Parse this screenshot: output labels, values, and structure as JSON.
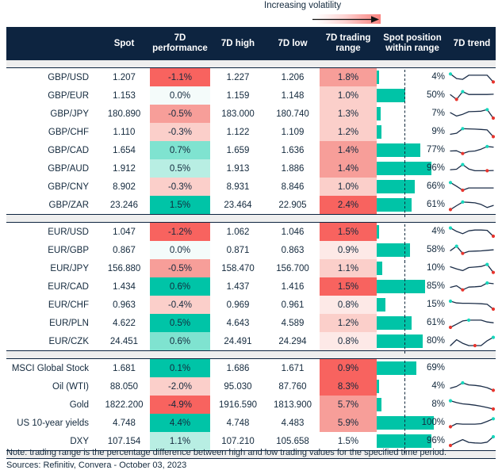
{
  "annotation": {
    "volatility_label": "Increasing volatility"
  },
  "columns": [
    {
      "key": "name",
      "label": ""
    },
    {
      "key": "spot",
      "label": "Spot"
    },
    {
      "key": "perf",
      "label": "7D performance"
    },
    {
      "key": "high",
      "label": "7D high"
    },
    {
      "key": "low",
      "label": "7D low"
    },
    {
      "key": "range",
      "label": "7D trading range"
    },
    {
      "key": "pos",
      "label": "Spot position within range"
    },
    {
      "key": "trend",
      "label": "7D trend"
    }
  ],
  "header": {
    "name": "",
    "spot": "Spot",
    "perf_line1": "7D",
    "perf_line2": "performance",
    "high": "7D high",
    "low": "7D low",
    "range_line1": "7D trading",
    "range_line2": "range",
    "pos_line1": "Spot position",
    "pos_line2": "within range",
    "trend": "7D trend"
  },
  "colors": {
    "header_bg": "#0d2440",
    "teal_strong": "#00c4a7",
    "teal_mid": "#7fe3d0",
    "teal_light": "#b8eee3",
    "red_strong": "#f8635f",
    "red_mid": "#f79e99",
    "red_light": "#fbcfca",
    "neutral": "#f4fbfa",
    "bar": "#00c4a7",
    "spark_line": "#1b2d48",
    "spark_high": "#16d8bd",
    "spark_low": "#e8352e",
    "text": "#13293d"
  },
  "sections": [
    {
      "id": "gbp",
      "rows": [
        {
          "name": "GBP/USD",
          "spot": "1.207",
          "perf": "-1.1%",
          "perf_color": "#f8635f",
          "high": "1.227",
          "low": "1.206",
          "range": "1.8%",
          "range_color": "#f79e99",
          "pos": "4%",
          "pos_pct": 4,
          "trend": [
            0.18,
            0.62,
            0.7,
            0.3,
            0.3,
            0.3,
            0.3,
            0.95
          ],
          "trend_high_i": 0,
          "trend_low_i": 7
        },
        {
          "name": "GBP/EUR",
          "spot": "1.153",
          "perf": "0.0%",
          "perf_color": "#f4fbfa",
          "high": "1.159",
          "low": "1.148",
          "range": "1.0%",
          "range_color": "#fbcfca",
          "pos": "50%",
          "pos_pct": 50,
          "trend": [
            0.42,
            0.88,
            0.12,
            0.4,
            0.4,
            0.4,
            0.4,
            0.38
          ],
          "trend_high_i": 2,
          "trend_low_i": 1
        },
        {
          "name": "GBP/JPY",
          "spot": "180.890",
          "perf": "-0.5%",
          "perf_color": "#f79e99",
          "high": "183.000",
          "low": "180.740",
          "range": "1.3%",
          "range_color": "#fbcfca",
          "pos": "7%",
          "pos_pct": 7,
          "trend": [
            0.4,
            0.72,
            0.55,
            0.3,
            0.28,
            0.25,
            0.1,
            0.92
          ],
          "trend_high_i": 6,
          "trend_low_i": 7
        },
        {
          "name": "GBP/CHF",
          "spot": "1.110",
          "perf": "-0.3%",
          "perf_color": "#fbcfca",
          "high": "1.122",
          "low": "1.109",
          "range": "1.2%",
          "range_color": "#fbcfca",
          "pos": "9%",
          "pos_pct": 9,
          "trend": [
            0.72,
            0.62,
            0.18,
            0.2,
            0.22,
            0.25,
            0.3,
            0.95
          ],
          "trend_high_i": 2,
          "trend_low_i": 7
        },
        {
          "name": "GBP/CAD",
          "spot": "1.654",
          "perf": "0.7%",
          "perf_color": "#7fe3d0",
          "high": "1.659",
          "low": "1.636",
          "range": "1.4%",
          "range_color": "#f79e99",
          "pos": "77%",
          "pos_pct": 77,
          "trend": [
            0.58,
            0.55,
            0.82,
            0.62,
            0.58,
            0.4,
            0.14,
            0.2
          ],
          "trend_high_i": 6,
          "trend_low_i": 2
        },
        {
          "name": "GBP/AUD",
          "spot": "1.912",
          "perf": "0.5%",
          "perf_color": "#b8eee3",
          "high": "1.913",
          "low": "1.886",
          "range": "1.4%",
          "range_color": "#f79e99",
          "pos": "96%",
          "pos_pct": 96,
          "trend": [
            0.62,
            0.58,
            0.12,
            0.55,
            0.72,
            0.72,
            0.72,
            0.7
          ],
          "trend_high_i": 2,
          "trend_low_i": 6
        },
        {
          "name": "GBP/CNY",
          "spot": "8.902",
          "perf": "-0.3%",
          "perf_color": "#fbcfca",
          "high": "8.931",
          "low": "8.846",
          "range": "1.0%",
          "range_color": "#fbcfca",
          "pos": "66%",
          "pos_pct": 66,
          "trend": [
            0.1,
            0.45,
            0.85,
            0.62,
            0.62,
            0.62,
            0.62,
            0.62
          ],
          "trend_high_i": 0,
          "trend_low_i": 2
        },
        {
          "name": "GBP/ZAR",
          "spot": "23.246",
          "perf": "1.5%",
          "perf_color": "#00c4a7",
          "high": "23.464",
          "low": "22.905",
          "range": "2.4%",
          "range_color": "#f8635f",
          "pos": "61%",
          "pos_pct": 61,
          "trend": [
            0.95,
            0.58,
            0.22,
            0.25,
            0.3,
            0.45,
            0.75,
            0.55
          ],
          "trend_high_i": 2,
          "trend_low_i": 0
        }
      ]
    },
    {
      "id": "eur",
      "rows": [
        {
          "name": "EUR/USD",
          "spot": "1.047",
          "perf": "-1.2%",
          "perf_color": "#f8635f",
          "high": "1.062",
          "low": "1.046",
          "range": "1.5%",
          "range_color": "#f8635f",
          "pos": "4%",
          "pos_pct": 4,
          "trend": [
            0.12,
            0.45,
            0.68,
            0.4,
            0.32,
            0.32,
            0.35,
            0.92
          ],
          "trend_high_i": 0,
          "trend_low_i": 7
        },
        {
          "name": "EUR/GBP",
          "spot": "0.867",
          "perf": "0.0%",
          "perf_color": "#f4fbfa",
          "high": "0.871",
          "low": "0.863",
          "range": "0.9%",
          "range_color": "#fde9e7",
          "pos": "58%",
          "pos_pct": 58,
          "trend": [
            0.55,
            0.12,
            0.82,
            0.62,
            0.6,
            0.58,
            0.52,
            0.48
          ],
          "trend_high_i": 1,
          "trend_low_i": 2
        },
        {
          "name": "EUR/JPY",
          "spot": "156.880",
          "perf": "-0.5%",
          "perf_color": "#f79e99",
          "high": "158.470",
          "low": "156.700",
          "range": "1.1%",
          "range_color": "#fbcfca",
          "pos": "10%",
          "pos_pct": 10,
          "trend": [
            0.35,
            0.55,
            0.72,
            0.42,
            0.38,
            0.32,
            0.12,
            0.9
          ],
          "trend_high_i": 6,
          "trend_low_i": 7
        },
        {
          "name": "EUR/CAD",
          "spot": "1.434",
          "perf": "0.6%",
          "perf_color": "#00c4a7",
          "high": "1.437",
          "low": "1.416",
          "range": "1.5%",
          "range_color": "#f8635f",
          "pos": "85%",
          "pos_pct": 85,
          "trend": [
            0.58,
            0.42,
            0.82,
            0.55,
            0.52,
            0.48,
            0.15,
            0.22
          ],
          "trend_high_i": 6,
          "trend_low_i": 2
        },
        {
          "name": "EUR/CHF",
          "spot": "0.963",
          "perf": "-0.4%",
          "perf_color": "#fbcfca",
          "high": "0.969",
          "low": "0.961",
          "range": "0.8%",
          "range_color": "#fde9e7",
          "pos": "15%",
          "pos_pct": 15,
          "trend": [
            0.15,
            0.32,
            0.35,
            0.35,
            0.38,
            0.4,
            0.45,
            0.92
          ],
          "trend_high_i": 0,
          "trend_low_i": 7
        },
        {
          "name": "EUR/PLN",
          "spot": "4.622",
          "perf": "0.5%",
          "perf_color": "#00c4a7",
          "high": "4.643",
          "low": "4.589",
          "range": "1.2%",
          "range_color": "#fbcfca",
          "pos": "61%",
          "pos_pct": 61,
          "trend": [
            0.92,
            0.62,
            0.3,
            0.22,
            0.22,
            0.22,
            0.4,
            0.48
          ],
          "trend_high_i": 3,
          "trend_low_i": 0
        },
        {
          "name": "EUR/CZK",
          "spot": "24.451",
          "perf": "0.6%",
          "perf_color": "#7fe3d0",
          "high": "24.491",
          "low": "24.294",
          "range": "0.8%",
          "range_color": "#fde9e7",
          "pos": "80%",
          "pos_pct": 80,
          "trend": [
            0.92,
            0.35,
            0.7,
            0.92,
            0.92,
            0.92,
            0.45,
            0.12
          ],
          "trend_high_i": 7,
          "trend_low_i": 4
        }
      ]
    },
    {
      "id": "other",
      "rows": [
        {
          "name": "MSCI Global Stock",
          "spot": "1.681",
          "perf": "0.1%",
          "perf_color": "#00c4a7",
          "high": "1.686",
          "low": "1.671",
          "range": "0.9%",
          "range_color": "#f8635f",
          "pos": "69%",
          "pos_pct": 69,
          "trend": [],
          "trend_high_i": -1,
          "trend_low_i": -1
        },
        {
          "name": "Oil (WTI)",
          "spot": "88.050",
          "perf": "-2.0%",
          "perf_color": "#fbcfca",
          "high": "95.030",
          "low": "87.760",
          "range": "8.3%",
          "range_color": "#f8635f",
          "pos": "4%",
          "pos_pct": 4,
          "trend": [
            0.68,
            0.5,
            0.15,
            0.35,
            0.4,
            0.48,
            0.62,
            0.88
          ],
          "trend_high_i": 2,
          "trend_low_i": 7
        },
        {
          "name": "Gold",
          "spot": "1822.200",
          "perf": "-4.9%",
          "perf_color": "#f8635f",
          "high": "1916.590",
          "low": "1813.900",
          "range": "5.7%",
          "range_color": "#f79e99",
          "pos": "8%",
          "pos_pct": 8,
          "trend": [
            0.12,
            0.3,
            0.42,
            0.48,
            0.55,
            0.65,
            0.78,
            0.92
          ],
          "trend_high_i": 0,
          "trend_low_i": 7
        },
        {
          "name": "US 10-year yields",
          "spot": "4.748",
          "perf": "4.4%",
          "perf_color": "#00c4a7",
          "high": "4.748",
          "low": "4.483",
          "range": "5.9%",
          "range_color": "#f79e99",
          "pos": "100%",
          "pos_pct": 100,
          "trend": [
            0.88,
            0.58,
            0.62,
            0.62,
            0.62,
            0.58,
            0.35,
            0.1
          ],
          "trend_high_i": 7,
          "trend_low_i": 0
        },
        {
          "name": "DXY",
          "spot": "107.154",
          "perf": "1.1%",
          "perf_color": "#b8eee3",
          "high": "107.210",
          "low": "105.658",
          "range": "1.5%",
          "range_color": "#ffffff",
          "pos": "96%",
          "pos_pct": 96,
          "trend": [
            0.92,
            0.62,
            0.35,
            0.62,
            0.68,
            0.7,
            0.6,
            0.08
          ],
          "trend_high_i": 7,
          "trend_low_i": 0
        }
      ]
    }
  ],
  "footer": {
    "note": "Note: trading range is the percentage difference between high and low trading values for the specified time period.",
    "sources": "Sources: Refinitiv, Convera - October 03, 2023"
  }
}
